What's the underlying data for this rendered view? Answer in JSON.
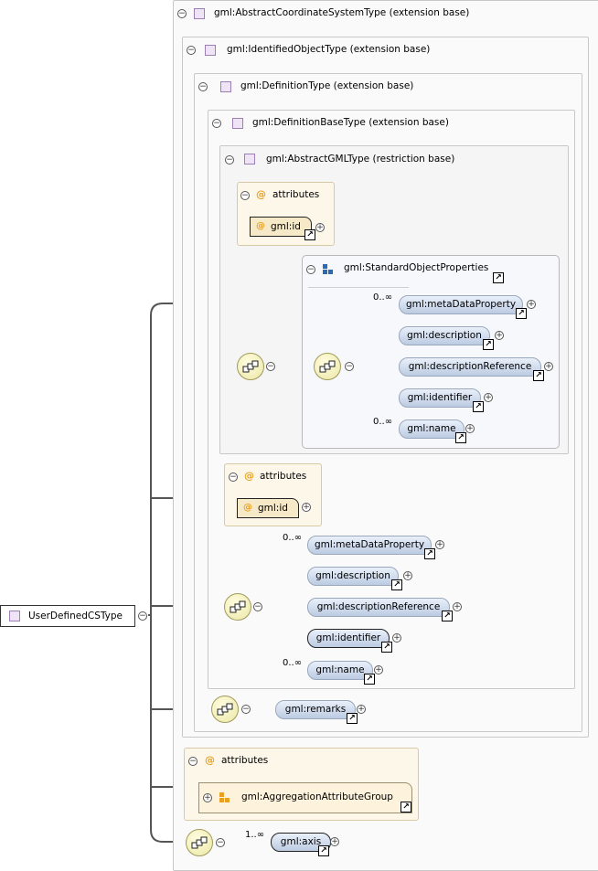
{
  "root": {
    "label": "UserDefinedCSType"
  },
  "levels": {
    "abstract_cs": "gml:AbstractCoordinateSystemType (extension base)",
    "identified": "gml:IdentifiedObjectType (extension base)",
    "definition": "gml:DefinitionType (extension base)",
    "definition_base": "gml:DefinitionBaseType (extension base)",
    "abstract_gml": "gml:AbstractGMLType (restriction base)"
  },
  "attributes_label": "attributes",
  "attr_id": "gml:id",
  "group": {
    "label": "gml:StandardObjectProperties"
  },
  "group_elements": [
    {
      "name": "gml:metaDataProperty",
      "card": "0..∞"
    },
    {
      "name": "gml:description",
      "card": ""
    },
    {
      "name": "gml:descriptionReference",
      "card": ""
    },
    {
      "name": "gml:identifier",
      "card": ""
    },
    {
      "name": "gml:name",
      "card": "0..∞"
    }
  ],
  "seq_elements": [
    {
      "name": "gml:metaDataProperty",
      "card": "0..∞"
    },
    {
      "name": "gml:description",
      "card": ""
    },
    {
      "name": "gml:descriptionReference",
      "card": ""
    },
    {
      "name": "gml:identifier",
      "card": ""
    },
    {
      "name": "gml:name",
      "card": "0..∞"
    }
  ],
  "remarks": "gml:remarks",
  "aggregation": "gml:AggregationAttributeGroup",
  "axis": {
    "name": "gml:axis",
    "card": "1..∞"
  },
  "symbols": {
    "minus": "−",
    "plus": "+",
    "at": "@",
    "jump": "↗"
  },
  "colors": {
    "frame": "#c8c8c8",
    "attr_bg": "#fdf7ea",
    "element_fill": "#bccbe2",
    "type_icon": "#efe4f5"
  }
}
